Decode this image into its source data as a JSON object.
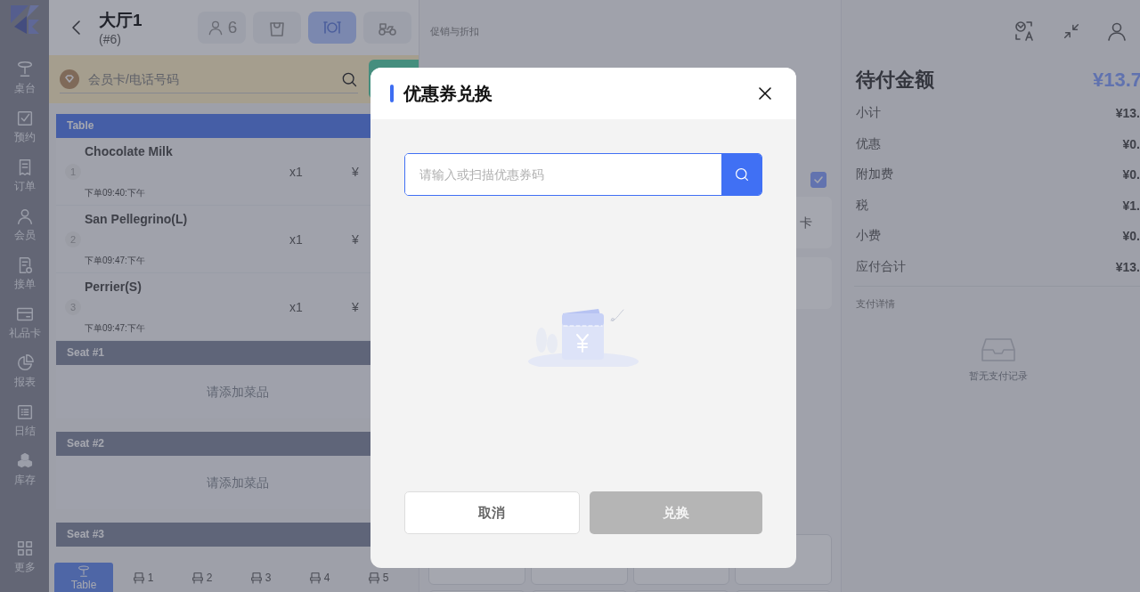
{
  "app": {
    "sidebar": {
      "items": [
        {
          "label": "桌台",
          "selected": false
        },
        {
          "label": "预约",
          "selected": false
        },
        {
          "label": "订单",
          "selected": false
        },
        {
          "label": "会员",
          "selected": false
        },
        {
          "label": "接单",
          "selected": false
        },
        {
          "label": "礼品卡",
          "selected": false
        },
        {
          "label": "报表",
          "selected": false
        },
        {
          "label": "日结",
          "selected": false
        },
        {
          "label": "库存",
          "selected": false
        }
      ],
      "more": {
        "label": "更多",
        "selected": false
      }
    },
    "order_panel": {
      "table_name": "大厅1",
      "order_no": "(#6)",
      "guest_count": "6",
      "service_modes": [
        {
          "selected": false
        },
        {
          "selected": true
        },
        {
          "selected": false
        }
      ],
      "member_search": {
        "placeholder": "会员卡/电话号码"
      },
      "sections": [
        {
          "title": "Table",
          "selected": true,
          "items": [
            {
              "index": "1",
              "name": "Chocolate Milk",
              "time": "下单09:40:下午",
              "qty": "x1",
              "price": "¥"
            },
            {
              "index": "2",
              "name": "San Pellegrino(L)",
              "time": "下单09:47:下午",
              "qty": "x1",
              "price": "¥"
            },
            {
              "index": "3",
              "name": "Perrier(S)",
              "time": "下单09:47:下午",
              "qty": "x1",
              "price": "¥"
            }
          ]
        },
        {
          "title": "Seat #1",
          "selected": false,
          "empty_text": "请添加菜品"
        },
        {
          "title": "Seat #2",
          "selected": false,
          "empty_text": "请添加菜品"
        },
        {
          "title": "Seat #3",
          "selected": false
        }
      ],
      "seat_tabs": [
        {
          "label": "Table",
          "selected": true
        },
        {
          "label": "1",
          "selected": false
        },
        {
          "label": "2",
          "selected": false
        },
        {
          "label": "3",
          "selected": false
        },
        {
          "label": "4",
          "selected": false
        },
        {
          "label": "5",
          "selected": false
        }
      ]
    },
    "promotions": {
      "title": "促销与折扣",
      "option": {
        "checked": true
      },
      "card_label": "卡"
    },
    "summary": {
      "title": "待付金额",
      "amount_due": "¥13.7",
      "rows": [
        {
          "label": "小计",
          "value": "¥13."
        },
        {
          "label": "优惠",
          "value": "¥0."
        },
        {
          "label": "附加费",
          "value": "¥0."
        },
        {
          "label": "税",
          "value": "¥1."
        },
        {
          "label": "小费",
          "value": "¥0."
        },
        {
          "label": "应付合计",
          "value": "¥13."
        }
      ],
      "payment_section": "支付详情",
      "empty_text": "暂无支付记录"
    }
  },
  "dialog": {
    "title": "优惠券兑换",
    "placeholder": "请输入或扫描优惠券码",
    "buttons": [
      {
        "label": "取消",
        "kind": "secondary",
        "disabled": false
      },
      {
        "label": "兑换",
        "kind": "primary",
        "disabled": true
      }
    ]
  }
}
